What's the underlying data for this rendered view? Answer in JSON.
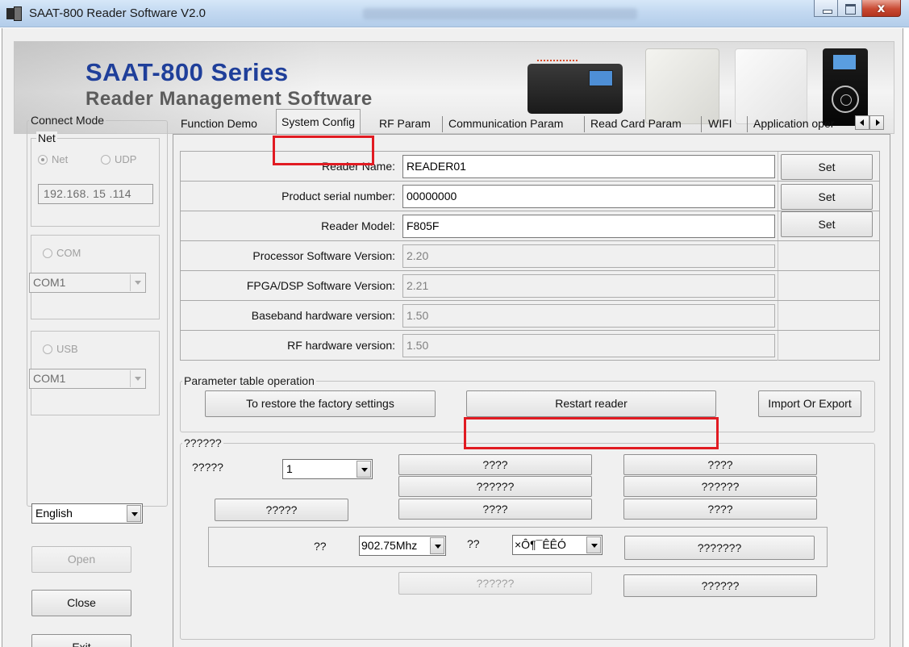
{
  "window": {
    "title": "SAAT-800 Reader Software V2.0",
    "close_glyph": "x"
  },
  "banner": {
    "title": "SAAT-800 Series",
    "subtitle": "Reader Management Software"
  },
  "connect": {
    "legend": "Connect Mode",
    "net_legend": "Net",
    "net_radio": "Net",
    "udp_radio": "UDP",
    "ip": "192.168. 15 .114",
    "com_radio": "COM",
    "com_value": "COM1",
    "usb_radio": "USB",
    "usb_value": "COM1",
    "language": "English",
    "open": "Open",
    "close": "Close",
    "exit": "Exit"
  },
  "tabs": [
    "Function Demo",
    "System Config",
    "RF Param",
    "Communication Param",
    "Read Card Param",
    "WIFI",
    "Application oper"
  ],
  "config": {
    "rows": [
      {
        "label": "Reader Name:",
        "value": "READER01",
        "button": "Set"
      },
      {
        "label": "Product serial number:",
        "value": "00000000",
        "button": "Set"
      },
      {
        "label": "Reader Model:",
        "value": "F805F",
        "button": "Set"
      },
      {
        "label": "Processor Software Version:",
        "value": "2.20"
      },
      {
        "label": "FPGA/DSP Software Version:",
        "value": "2.21"
      },
      {
        "label": "Baseband hardware version:",
        "value": "1.50"
      },
      {
        "label": "RF hardware version:",
        "value": "1.50"
      }
    ],
    "param_legend": "Parameter table operation",
    "restore": "To restore the factory settings",
    "restart": "Restart reader",
    "import_export": "Import Or Export"
  },
  "test": {
    "legend": "??????",
    "label1": "?????",
    "combo1": "1",
    "btn_a1": "????",
    "btn_a2": "??????",
    "btn_a3": "????",
    "btn_b1": "????",
    "btn_b2": "??????",
    "btn_b3": "????",
    "btn_left": "?????",
    "freq_label": "??",
    "freq_value": "902.75Mhz",
    "mode_label": "??",
    "mode_value": "×Ô¶¯ÊÊÓ",
    "btn_c1": "???????",
    "btn_d_disabled": "??????",
    "btn_d2": "??????"
  },
  "colors": {
    "highlight": "#e11b22",
    "banner_title": "#1f3f9a"
  }
}
